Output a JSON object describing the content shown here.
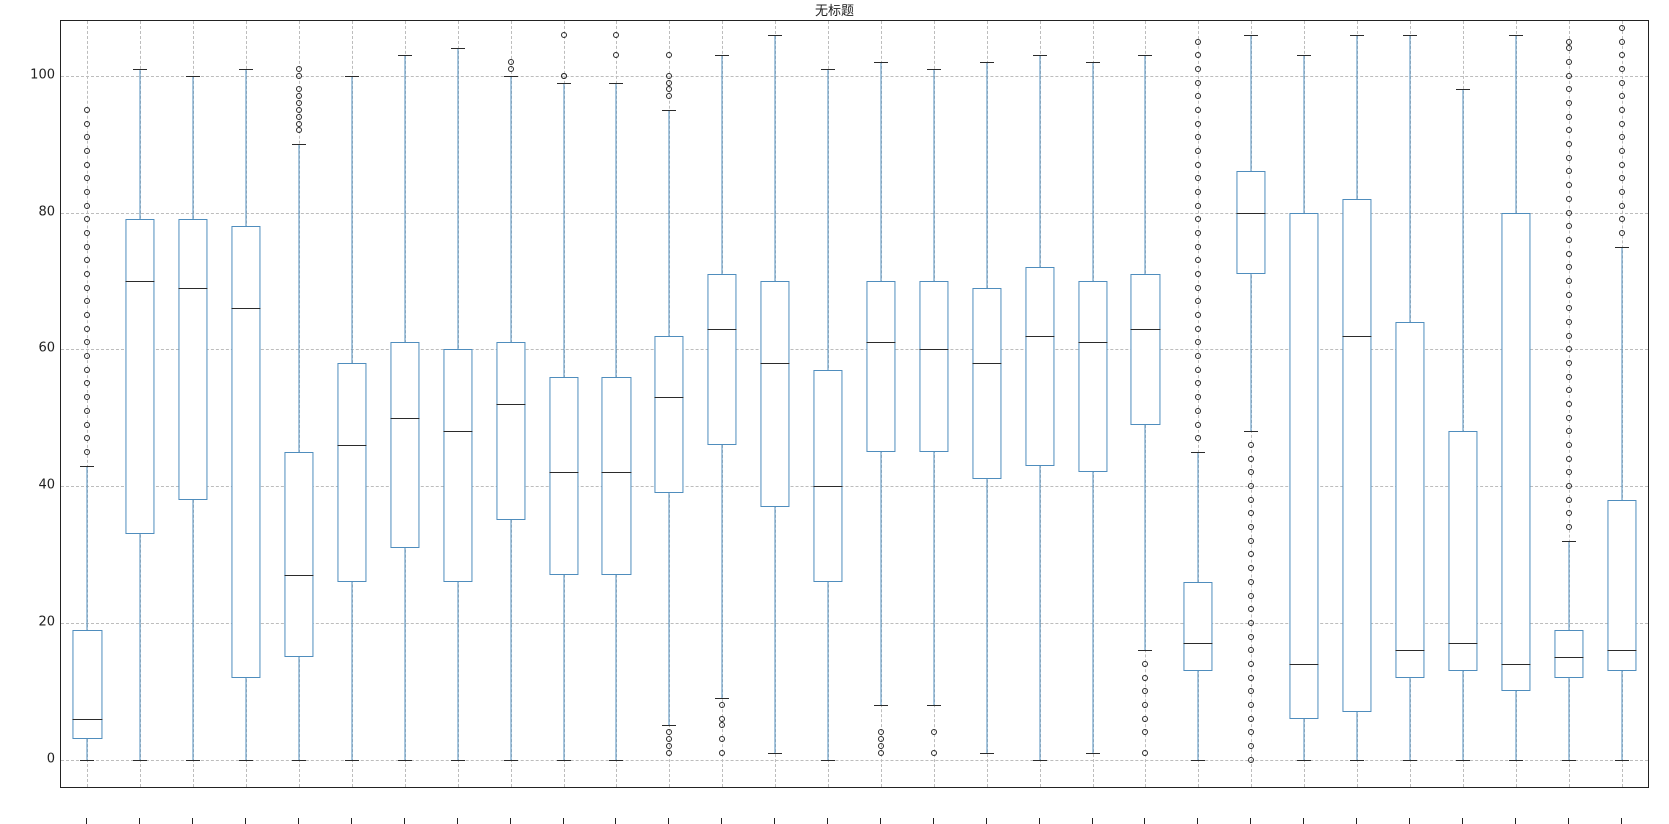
{
  "title": "无标题",
  "chart_data": {
    "type": "boxplot",
    "ylim": [
      -4,
      108
    ],
    "yticks": [
      0,
      20,
      40,
      60,
      80,
      100
    ],
    "grid": true,
    "box_width_ratio": 0.55,
    "colors": {
      "box_edge": "#4f8dbd",
      "whisker": "#4f8dbd",
      "median": "#2b2b2b",
      "cap": "#2b2b2b",
      "flier": "#2b2b2b"
    },
    "n": 30,
    "boxes": [
      {
        "q1": 3,
        "median": 6,
        "q3": 19,
        "whisker_lo": 0,
        "whisker_hi": 43,
        "fliers": [
          45,
          47,
          49,
          51,
          53,
          55,
          57,
          59,
          61,
          63,
          65,
          67,
          69,
          71,
          73,
          75,
          77,
          79,
          81,
          83,
          85,
          87,
          89,
          91,
          93,
          95
        ]
      },
      {
        "q1": 33,
        "median": 70,
        "q3": 79,
        "whisker_lo": 0,
        "whisker_hi": 101,
        "fliers": []
      },
      {
        "q1": 38,
        "median": 69,
        "q3": 79,
        "whisker_lo": 0,
        "whisker_hi": 100,
        "fliers": []
      },
      {
        "q1": 12,
        "median": 66,
        "q3": 78,
        "whisker_lo": 0,
        "whisker_hi": 101,
        "fliers": []
      },
      {
        "q1": 15,
        "median": 27,
        "q3": 45,
        "whisker_lo": 0,
        "whisker_hi": 90,
        "fliers": [
          92,
          93,
          94,
          95,
          96,
          97,
          98,
          100,
          101
        ]
      },
      {
        "q1": 26,
        "median": 46,
        "q3": 58,
        "whisker_lo": 0,
        "whisker_hi": 100,
        "fliers": []
      },
      {
        "q1": 31,
        "median": 50,
        "q3": 61,
        "whisker_lo": 0,
        "whisker_hi": 103,
        "fliers": []
      },
      {
        "q1": 26,
        "median": 48,
        "q3": 60,
        "whisker_lo": 0,
        "whisker_hi": 104,
        "fliers": []
      },
      {
        "q1": 35,
        "median": 52,
        "q3": 61,
        "whisker_lo": 0,
        "whisker_hi": 100,
        "fliers": [
          101,
          102
        ]
      },
      {
        "q1": 27,
        "median": 42,
        "q3": 56,
        "whisker_lo": 0,
        "whisker_hi": 99,
        "fliers": [
          100,
          100,
          106
        ]
      },
      {
        "q1": 27,
        "median": 42,
        "q3": 56,
        "whisker_lo": 0,
        "whisker_hi": 99,
        "fliers": [
          103,
          106
        ]
      },
      {
        "q1": 39,
        "median": 53,
        "q3": 62,
        "whisker_lo": 5,
        "whisker_hi": 95,
        "fliers": [
          1,
          2,
          3,
          4,
          97,
          98,
          99,
          100,
          103
        ]
      },
      {
        "q1": 46,
        "median": 63,
        "q3": 71,
        "whisker_lo": 9,
        "whisker_hi": 103,
        "fliers": [
          1,
          3,
          5,
          6,
          8
        ]
      },
      {
        "q1": 37,
        "median": 58,
        "q3": 70,
        "whisker_lo": 1,
        "whisker_hi": 106,
        "fliers": []
      },
      {
        "q1": 26,
        "median": 40,
        "q3": 57,
        "whisker_lo": 0,
        "whisker_hi": 101,
        "fliers": []
      },
      {
        "q1": 45,
        "median": 61,
        "q3": 70,
        "whisker_lo": 8,
        "whisker_hi": 102,
        "fliers": [
          1,
          2,
          3,
          4
        ]
      },
      {
        "q1": 45,
        "median": 60,
        "q3": 70,
        "whisker_lo": 8,
        "whisker_hi": 101,
        "fliers": [
          1,
          4
        ]
      },
      {
        "q1": 41,
        "median": 58,
        "q3": 69,
        "whisker_lo": 1,
        "whisker_hi": 102,
        "fliers": []
      },
      {
        "q1": 43,
        "median": 62,
        "q3": 72,
        "whisker_lo": 0,
        "whisker_hi": 103,
        "fliers": []
      },
      {
        "q1": 42,
        "median": 61,
        "q3": 70,
        "whisker_lo": 1,
        "whisker_hi": 102,
        "fliers": []
      },
      {
        "q1": 49,
        "median": 63,
        "q3": 71,
        "whisker_lo": 16,
        "whisker_hi": 103,
        "fliers": [
          1,
          4,
          6,
          8,
          10,
          12,
          14
        ]
      },
      {
        "q1": 13,
        "median": 17,
        "q3": 26,
        "whisker_lo": 0,
        "whisker_hi": 45,
        "fliers": [
          47,
          49,
          51,
          53,
          55,
          57,
          59,
          61,
          63,
          65,
          67,
          69,
          71,
          73,
          75,
          77,
          79,
          81,
          83,
          85,
          87,
          89,
          91,
          93,
          95,
          97,
          99,
          101,
          103,
          105
        ]
      },
      {
        "q1": 71,
        "median": 80,
        "q3": 86,
        "whisker_lo": 48,
        "whisker_hi": 106,
        "fliers": [
          0,
          2,
          4,
          6,
          8,
          10,
          12,
          14,
          16,
          18,
          20,
          22,
          24,
          26,
          28,
          30,
          32,
          34,
          36,
          38,
          40,
          42,
          44,
          46
        ]
      },
      {
        "q1": 6,
        "median": 14,
        "q3": 80,
        "whisker_lo": 0,
        "whisker_hi": 103,
        "fliers": []
      },
      {
        "q1": 7,
        "median": 62,
        "q3": 82,
        "whisker_lo": 0,
        "whisker_hi": 106,
        "fliers": []
      },
      {
        "q1": 12,
        "median": 16,
        "q3": 64,
        "whisker_lo": 0,
        "whisker_hi": 106,
        "fliers": []
      },
      {
        "q1": 13,
        "median": 17,
        "q3": 48,
        "whisker_lo": 0,
        "whisker_hi": 98,
        "fliers": []
      },
      {
        "q1": 10,
        "median": 14,
        "q3": 80,
        "whisker_lo": 0,
        "whisker_hi": 106,
        "fliers": []
      },
      {
        "q1": 12,
        "median": 15,
        "q3": 19,
        "whisker_lo": 0,
        "whisker_hi": 32,
        "fliers": [
          34,
          36,
          38,
          40,
          42,
          44,
          46,
          48,
          50,
          52,
          54,
          56,
          58,
          60,
          62,
          64,
          66,
          68,
          70,
          72,
          74,
          76,
          78,
          80,
          82,
          84,
          86,
          88,
          90,
          92,
          94,
          96,
          98,
          100,
          102,
          104,
          105
        ]
      },
      {
        "q1": 13,
        "median": 16,
        "q3": 38,
        "whisker_lo": 0,
        "whisker_hi": 75,
        "fliers": [
          77,
          79,
          81,
          83,
          85,
          87,
          89,
          91,
          93,
          95,
          97,
          99,
          101,
          103,
          105,
          107
        ]
      }
    ]
  },
  "ylabels": {
    "0": "0",
    "20": "20",
    "40": "40",
    "60": "60",
    "80": "80",
    "100": "100"
  }
}
